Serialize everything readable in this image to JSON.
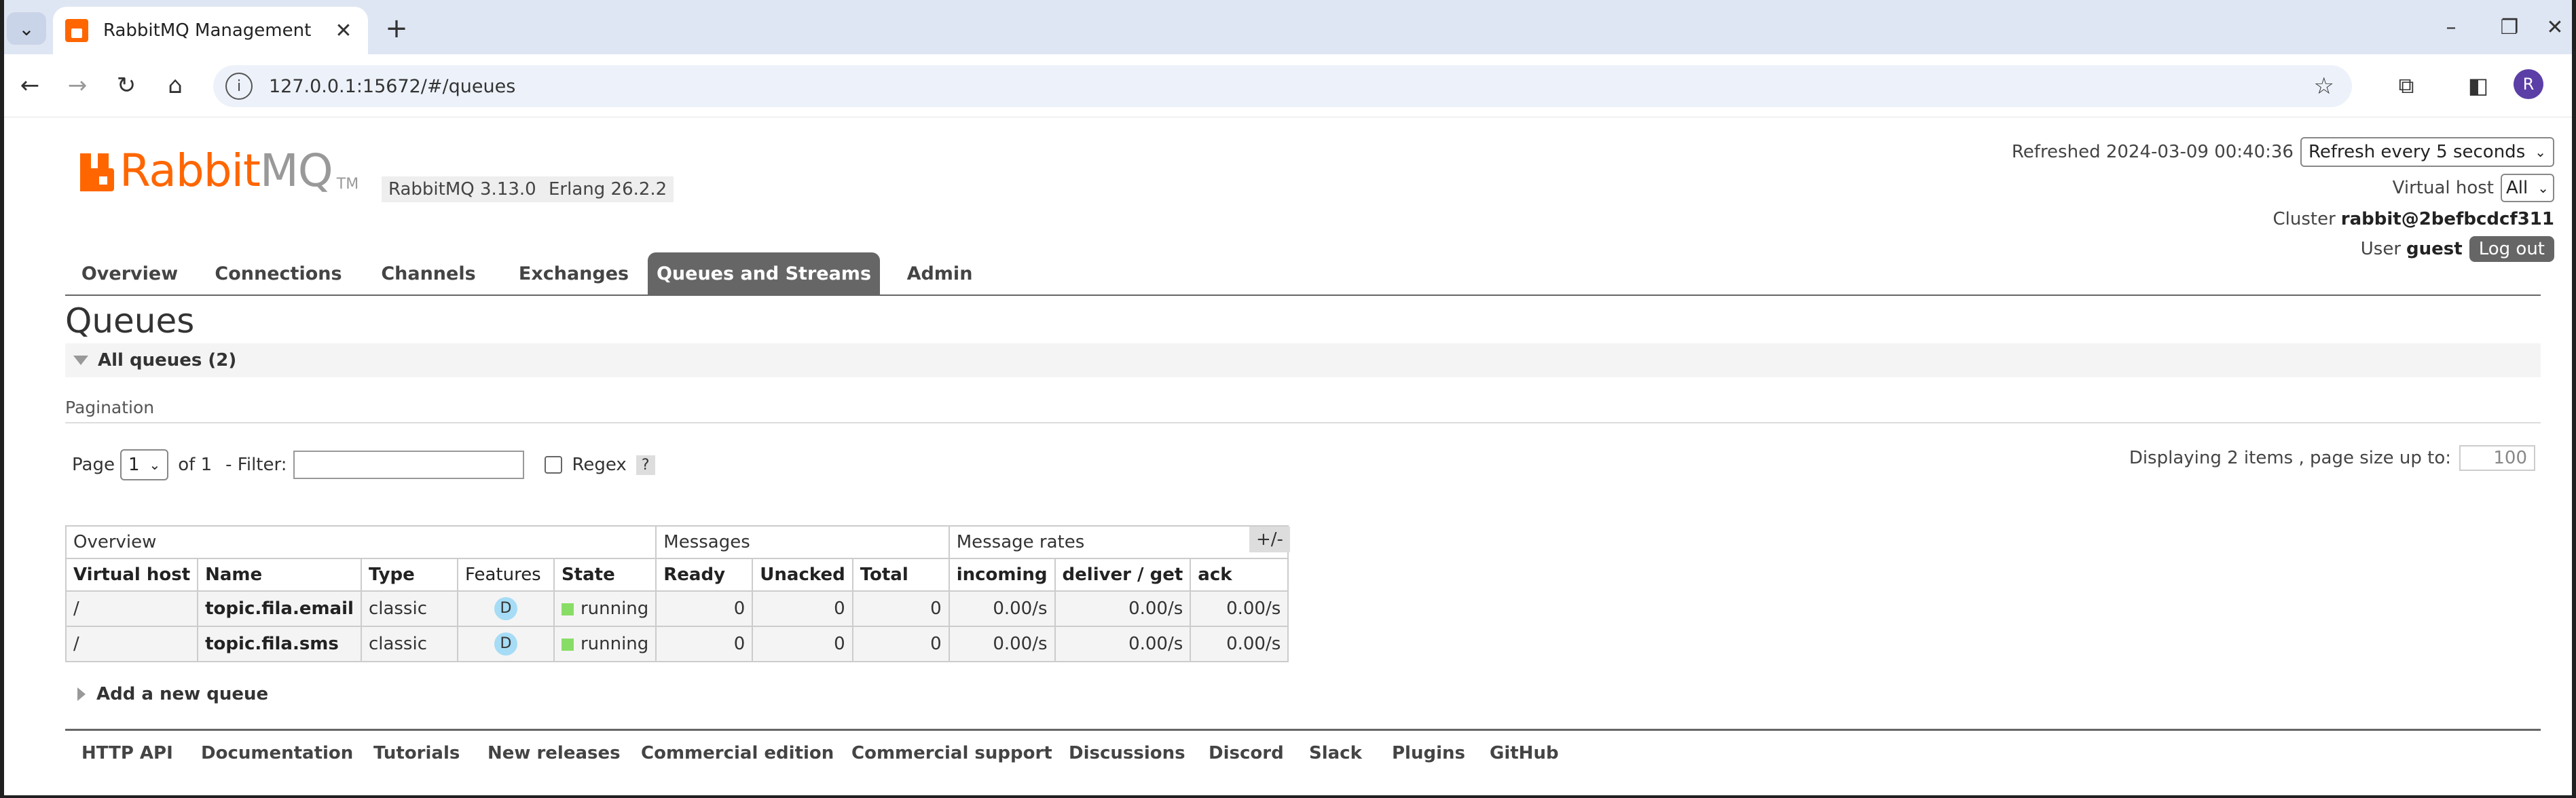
{
  "browser": {
    "tab_title": "RabbitMQ Management",
    "url": "127.0.0.1:15672/#/queues",
    "profile_initial": "R"
  },
  "header": {
    "logo_rabbit": "Rabbit",
    "logo_mq": "MQ",
    "logo_tm": "TM",
    "version": "RabbitMQ 3.13.0",
    "erlang": "Erlang 26.2.2",
    "refreshed_label": "Refreshed 2024-03-09 00:40:36",
    "refresh_option": "Refresh every 5 seconds",
    "vhost_label": "Virtual host",
    "vhost_value": "All",
    "cluster_label": "Cluster",
    "cluster_value": "rabbit@2befbcdcf311",
    "user_label": "User",
    "user_value": "guest",
    "logout": "Log out"
  },
  "nav": [
    "Overview",
    "Connections",
    "Channels",
    "Exchanges",
    "Queues and Streams",
    "Admin"
  ],
  "nav_active": "Queues and Streams",
  "page_title": "Queues",
  "section_title": "All queues (2)",
  "pagination": {
    "heading": "Pagination",
    "page_label": "Page",
    "page_value": "1",
    "of_label": "of 1",
    "filter_label": "- Filter:",
    "regex_label": "Regex",
    "help": "?",
    "displaying": "Displaying 2 items , page size up to:",
    "page_size": "100"
  },
  "table": {
    "groups": [
      "Overview",
      "Messages",
      "Message rates"
    ],
    "plus_minus": "+/-",
    "columns": [
      "Virtual host",
      "Name",
      "Type",
      "Features",
      "State",
      "Ready",
      "Unacked",
      "Total",
      "incoming",
      "deliver / get",
      "ack"
    ],
    "rows": [
      {
        "vhost": "/",
        "name": "topic.fila.email",
        "type": "classic",
        "feature": "D",
        "state": "running",
        "ready": "0",
        "unacked": "0",
        "total": "0",
        "incoming": "0.00/s",
        "deliver": "0.00/s",
        "ack": "0.00/s"
      },
      {
        "vhost": "/",
        "name": "topic.fila.sms",
        "type": "classic",
        "feature": "D",
        "state": "running",
        "ready": "0",
        "unacked": "0",
        "total": "0",
        "incoming": "0.00/s",
        "deliver": "0.00/s",
        "ack": "0.00/s"
      }
    ]
  },
  "add_queue": "Add a new queue",
  "footer": [
    "HTTP API",
    "Documentation",
    "Tutorials",
    "New releases",
    "Commercial edition",
    "Commercial support",
    "Discussions",
    "Discord",
    "Slack",
    "Plugins",
    "GitHub"
  ],
  "colors": {
    "brand": "#ff6600",
    "nav_active": "#666666",
    "running": "#88dd66",
    "feature_badge": "#a6dcf5"
  }
}
